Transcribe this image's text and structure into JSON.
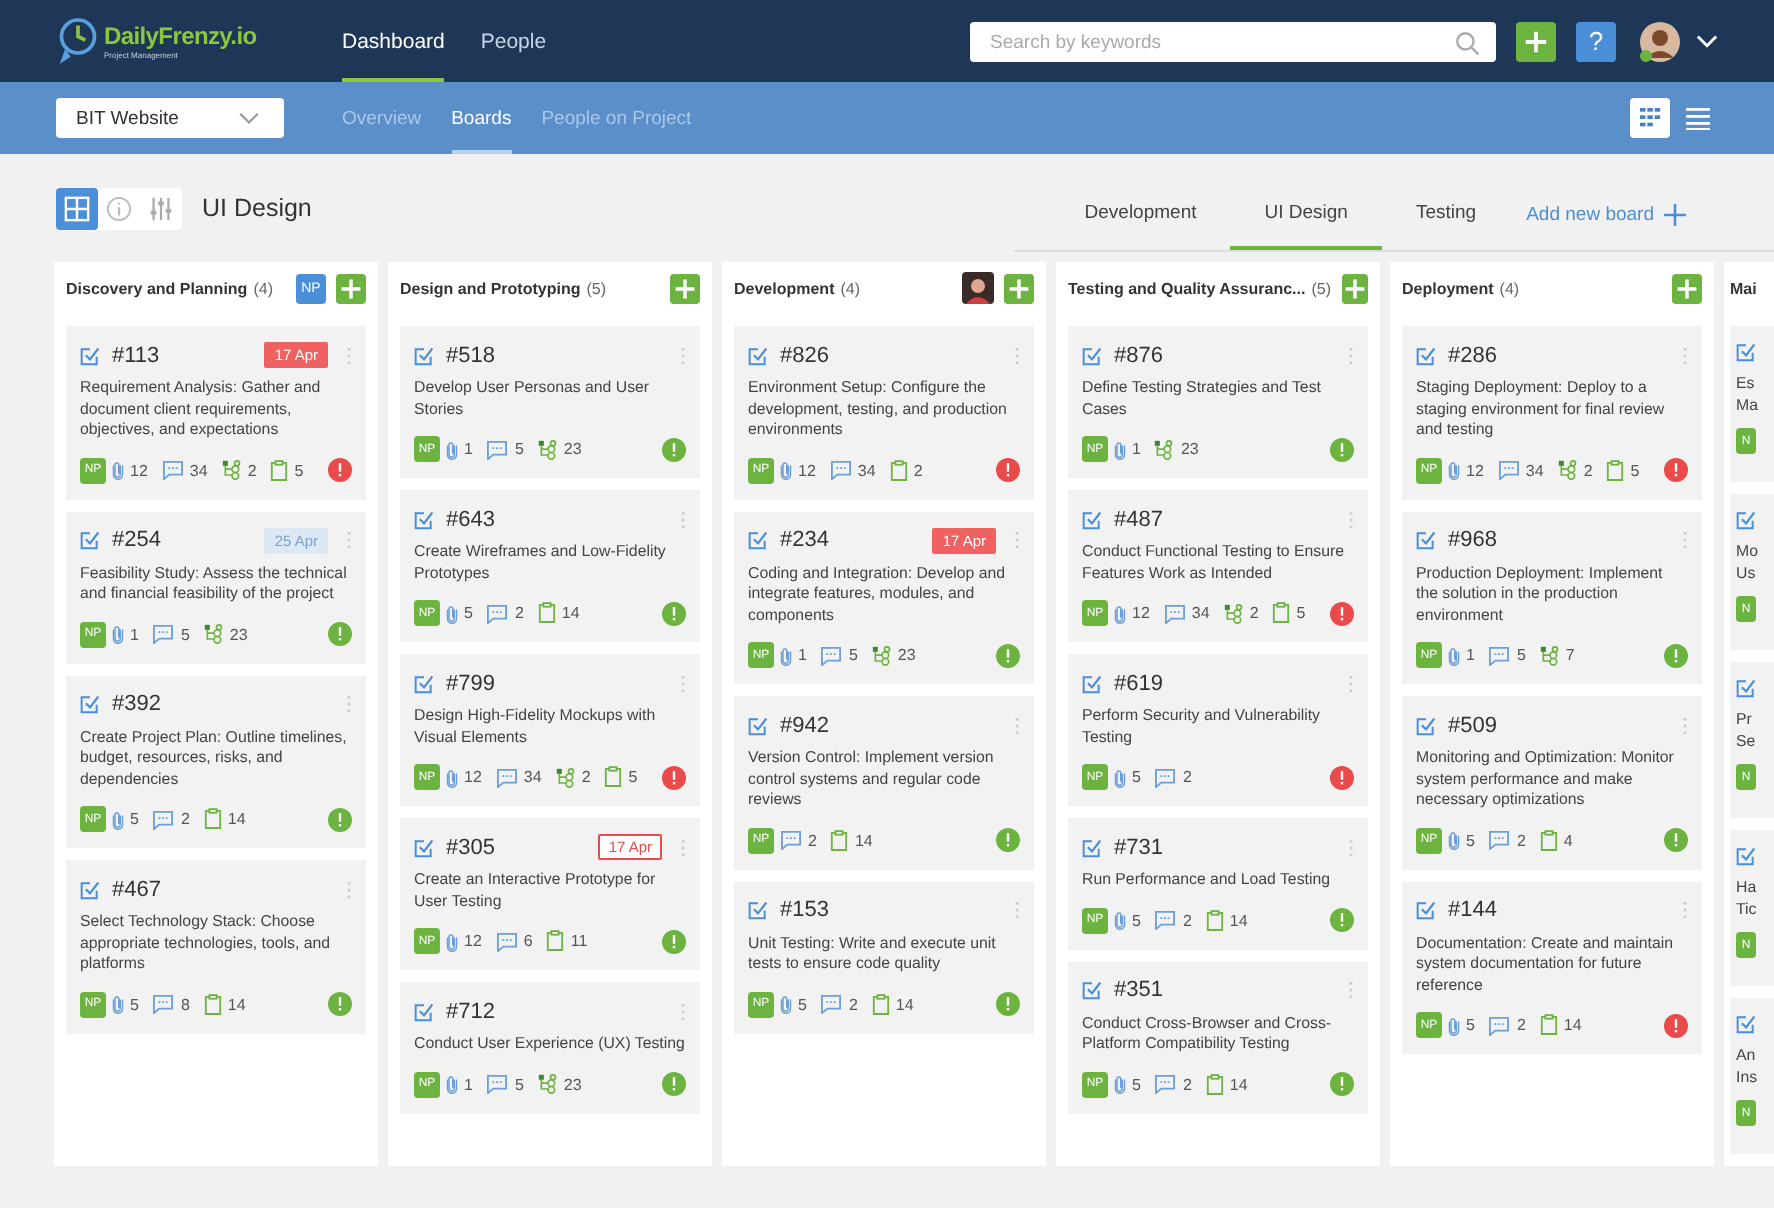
{
  "header": {
    "logo": {
      "name": "DailyFrenzy.io",
      "tagline": "Project Management"
    },
    "nav": [
      {
        "label": "Dashboard",
        "selected": true
      },
      {
        "label": "People",
        "selected": false
      }
    ],
    "search": {
      "placeholder": "Search by keywords"
    },
    "help_label": "?",
    "user": {
      "online": true
    }
  },
  "subheader": {
    "project": "BIT Website",
    "tabs": [
      {
        "label": "Overview",
        "selected": false
      },
      {
        "label": "Boards",
        "selected": true
      },
      {
        "label": "People on Project",
        "selected": false
      }
    ],
    "views": [
      {
        "kind": "grid",
        "selected": true
      },
      {
        "kind": "list",
        "selected": false
      }
    ]
  },
  "board": {
    "tools": [
      {
        "kind": "grid",
        "selected": true
      },
      {
        "kind": "info",
        "selected": false
      },
      {
        "kind": "filters",
        "selected": false
      }
    ],
    "title": "UI Design",
    "tabs": [
      {
        "label": "Development",
        "selected": false
      },
      {
        "label": "UI Design",
        "selected": true
      },
      {
        "label": "Testing",
        "selected": false
      }
    ],
    "add_board": "Add new board"
  },
  "columns": [
    {
      "title": "Discovery and Planning",
      "count": "(4)",
      "assignee": {
        "kind": "initials",
        "text": "NP"
      },
      "cards": [
        {
          "id": "#113",
          "date": {
            "text": "17 Apr",
            "kind": "overdue"
          },
          "description": "Requirement Analysis: Gather and document client requirements, objectives, and expectations",
          "avatar": "NP",
          "stats": [
            {
              "kind": "attachments",
              "value": "12"
            },
            {
              "kind": "comments",
              "value": "34"
            },
            {
              "kind": "subtasks",
              "value": "2"
            },
            {
              "kind": "clipboard",
              "value": "5"
            }
          ],
          "urgent": true
        },
        {
          "id": "#254",
          "date": {
            "text": "25 Apr",
            "kind": "upcoming"
          },
          "description": "Feasibility Study: Assess the technical and financial feasibility of the project",
          "avatar": "NP",
          "stats": [
            {
              "kind": "attachments",
              "value": "1"
            },
            {
              "kind": "comments",
              "value": "5"
            },
            {
              "kind": "subtasks",
              "value": "23"
            }
          ],
          "urgent": false
        },
        {
          "id": "#392",
          "description": "Create Project Plan: Outline timelines, budget, resources, risks, and dependencies",
          "avatar": "NP",
          "stats": [
            {
              "kind": "attachments",
              "value": "5"
            },
            {
              "kind": "comments",
              "value": "2"
            },
            {
              "kind": "clipboard",
              "value": "14"
            }
          ],
          "urgent": false
        },
        {
          "id": "#467",
          "description": "Select Technology Stack: Choose appropriate technologies, tools, and platforms",
          "avatar": "NP",
          "stats": [
            {
              "kind": "attachments",
              "value": "5"
            },
            {
              "kind": "comments",
              "value": "8"
            },
            {
              "kind": "clipboard",
              "value": "14"
            }
          ],
          "urgent": false
        }
      ]
    },
    {
      "title": "Design and Prototyping",
      "count": "(5)",
      "cards": [
        {
          "id": "#518",
          "description": "Develop User Personas and User Stories",
          "avatar": "NP",
          "stats": [
            {
              "kind": "attachments",
              "value": "1"
            },
            {
              "kind": "comments",
              "value": "5"
            },
            {
              "kind": "subtasks",
              "value": "23"
            }
          ],
          "urgent": false
        },
        {
          "id": "#643",
          "description": "Create Wireframes and Low-Fidelity Prototypes",
          "avatar": "NP",
          "stats": [
            {
              "kind": "attachments",
              "value": "5"
            },
            {
              "kind": "comments",
              "value": "2"
            },
            {
              "kind": "clipboard",
              "value": "14"
            }
          ],
          "urgent": false
        },
        {
          "id": "#799",
          "description": "Design High-Fidelity Mockups with Visual Elements",
          "avatar": "NP",
          "stats": [
            {
              "kind": "attachments",
              "value": "12"
            },
            {
              "kind": "comments",
              "value": "34"
            },
            {
              "kind": "subtasks",
              "value": "2"
            },
            {
              "kind": "clipboard",
              "value": "5"
            }
          ],
          "urgent": true
        },
        {
          "id": "#305",
          "date": {
            "text": "17 Apr",
            "kind": "due_soon"
          },
          "description": "Create an Interactive Prototype for User Testing",
          "avatar": "NP",
          "stats": [
            {
              "kind": "attachments",
              "value": "12"
            },
            {
              "kind": "comments",
              "value": "6"
            },
            {
              "kind": "clipboard",
              "value": "11"
            }
          ],
          "urgent": false
        },
        {
          "id": "#712",
          "description": "Conduct User Experience (UX) Testing",
          "avatar": "NP",
          "stats": [
            {
              "kind": "attachments",
              "value": "1"
            },
            {
              "kind": "comments",
              "value": "5"
            },
            {
              "kind": "subtasks",
              "value": "23"
            }
          ],
          "urgent": false
        }
      ]
    },
    {
      "title": "Development",
      "count": "(4)",
      "assignee": {
        "kind": "photo"
      },
      "cards": [
        {
          "id": "#826",
          "description": "Environment Setup: Configure the development, testing, and production environments",
          "avatar": "NP",
          "stats": [
            {
              "kind": "attachments",
              "value": "12"
            },
            {
              "kind": "comments",
              "value": "34"
            },
            {
              "kind": "clipboard",
              "value": "2"
            }
          ],
          "urgent": true
        },
        {
          "id": "#234",
          "date": {
            "text": "17 Apr",
            "kind": "overdue"
          },
          "description": "Coding and Integration: Develop and integrate features, modules, and components",
          "avatar": "NP",
          "stats": [
            {
              "kind": "attachments",
              "value": "1"
            },
            {
              "kind": "comments",
              "value": "5"
            },
            {
              "kind": "subtasks",
              "value": "23"
            }
          ],
          "urgent": false
        },
        {
          "id": "#942",
          "description": "Version Control: Implement version control systems and regular code reviews",
          "avatar": "NP",
          "stats": [
            {
              "kind": "comments",
              "value": "2"
            },
            {
              "kind": "clipboard",
              "value": "14"
            }
          ],
          "urgent": false
        },
        {
          "id": "#153",
          "description": "Unit Testing: Write and execute unit tests to ensure code quality",
          "avatar": "NP",
          "stats": [
            {
              "kind": "attachments",
              "value": "5"
            },
            {
              "kind": "comments",
              "value": "2"
            },
            {
              "kind": "clipboard",
              "value": "14"
            }
          ],
          "urgent": false
        }
      ]
    },
    {
      "title": "Testing and Quality Assuranc...",
      "count": "(5)",
      "cards": [
        {
          "id": "#876",
          "description": "Define Testing Strategies and Test Cases",
          "avatar": "NP",
          "stats": [
            {
              "kind": "attachments",
              "value": "1"
            },
            {
              "kind": "subtasks",
              "value": "23"
            }
          ],
          "urgent": false
        },
        {
          "id": "#487",
          "description": "Conduct Functional Testing to Ensure Features Work as Intended",
          "avatar": "NP",
          "stats": [
            {
              "kind": "attachments",
              "value": "12"
            },
            {
              "kind": "comments",
              "value": "34"
            },
            {
              "kind": "subtasks",
              "value": "2"
            },
            {
              "kind": "clipboard",
              "value": "5"
            }
          ],
          "urgent": true
        },
        {
          "id": "#619",
          "description": "Perform Security and Vulnerability Testing",
          "avatar": "NP",
          "stats": [
            {
              "kind": "attachments",
              "value": "5"
            },
            {
              "kind": "comments",
              "value": "2"
            }
          ],
          "urgent": true
        },
        {
          "id": "#731",
          "description": "Run Performance and Load Testing",
          "avatar": "NP",
          "stats": [
            {
              "kind": "attachments",
              "value": "5"
            },
            {
              "kind": "comments",
              "value": "2"
            },
            {
              "kind": "clipboard",
              "value": "14"
            }
          ],
          "urgent": false
        },
        {
          "id": "#351",
          "description": "Conduct Cross-Browser and Cross-Platform Compatibility Testing",
          "avatar": "NP",
          "stats": [
            {
              "kind": "attachments",
              "value": "5"
            },
            {
              "kind": "comments",
              "value": "2"
            },
            {
              "kind": "clipboard",
              "value": "14"
            }
          ],
          "urgent": false
        }
      ]
    },
    {
      "title": "Deployment",
      "count": "(4)",
      "cards": [
        {
          "id": "#286",
          "description": "Staging Deployment: Deploy to a staging environment for final review and testing",
          "avatar": "NP",
          "stats": [
            {
              "kind": "attachments",
              "value": "12"
            },
            {
              "kind": "comments",
              "value": "34"
            },
            {
              "kind": "subtasks",
              "value": "2"
            },
            {
              "kind": "clipboard",
              "value": "5"
            }
          ],
          "urgent": true
        },
        {
          "id": "#968",
          "description": "Production Deployment: Implement the solution in the production environment",
          "avatar": "NP",
          "stats": [
            {
              "kind": "attachments",
              "value": "1"
            },
            {
              "kind": "comments",
              "value": "5"
            },
            {
              "kind": "subtasks",
              "value": "7"
            }
          ],
          "urgent": false
        },
        {
          "id": "#509",
          "description": "Monitoring and Optimization: Monitor system performance and make necessary optimizations",
          "avatar": "NP",
          "stats": [
            {
              "kind": "attachments",
              "value": "5"
            },
            {
              "kind": "comments",
              "value": "2"
            },
            {
              "kind": "clipboard",
              "value": "4"
            }
          ],
          "urgent": false
        },
        {
          "id": "#144",
          "description": "Documentation: Create and maintain system documentation for future reference",
          "avatar": "NP",
          "stats": [
            {
              "kind": "attachments",
              "value": "5"
            },
            {
              "kind": "comments",
              "value": "2"
            },
            {
              "kind": "clipboard",
              "value": "14"
            }
          ],
          "urgent": true
        }
      ]
    }
  ],
  "partial_column": {
    "title": "Mai",
    "cards": [
      {
        "description": "Es Ma",
        "avatar": "N"
      },
      {
        "description": "Mo Us",
        "avatar": "N"
      },
      {
        "description": "Pr Se",
        "avatar": "N"
      },
      {
        "description": "Ha Tic",
        "avatar": "N"
      },
      {
        "description": "An Ins",
        "avatar": "N"
      }
    ]
  }
}
